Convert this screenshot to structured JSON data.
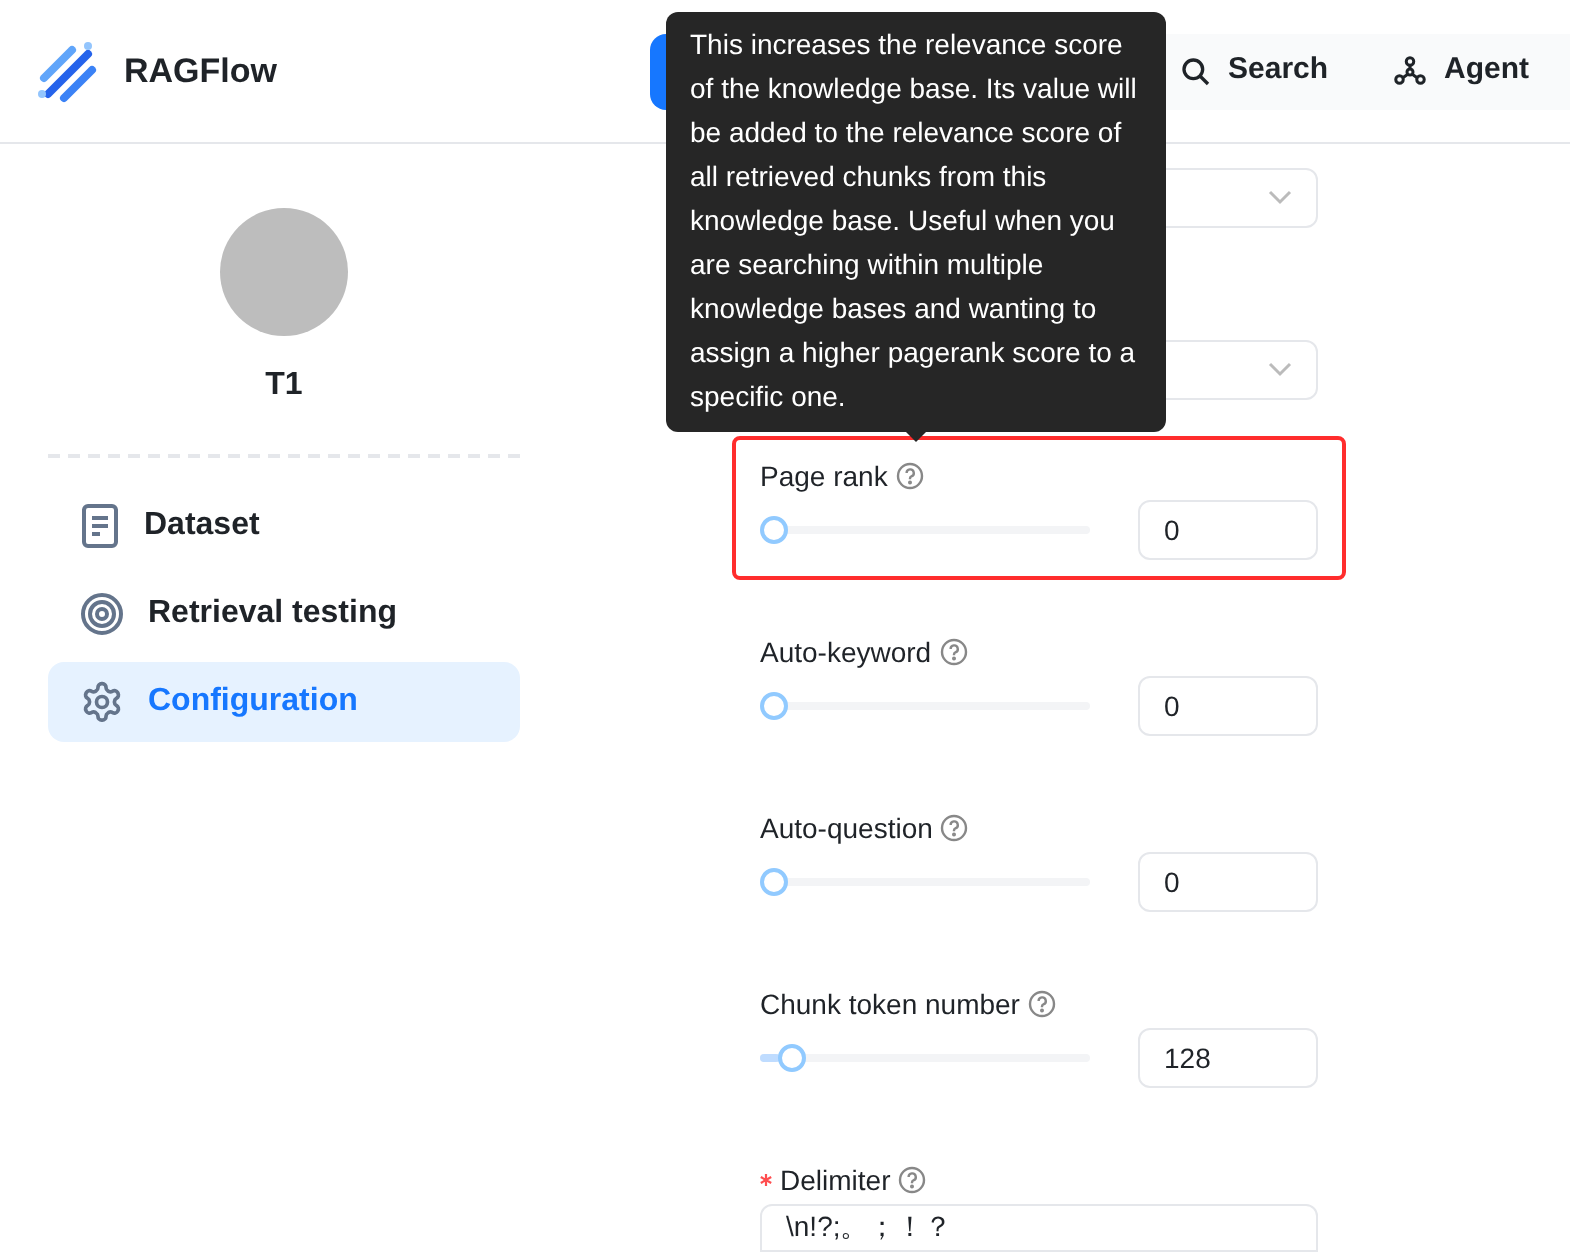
{
  "app": {
    "name": "RAGFlow"
  },
  "nav": [
    {
      "selected": true
    },
    {
      "label": "Search",
      "selected": false
    },
    {
      "label": "Agent",
      "selected": false
    }
  ],
  "sidebar": {
    "avatar_name": "T1",
    "items": [
      {
        "label": "Dataset",
        "selected": false
      },
      {
        "label": "Retrieval testing",
        "selected": false
      },
      {
        "label": "Configuration",
        "selected": true
      }
    ]
  },
  "form": [
    {
      "kind": "select",
      "highlighted": false
    },
    {
      "kind": "select",
      "highlighted": false
    },
    {
      "kind": "slider",
      "label": "Page rank",
      "required": false,
      "level": 0,
      "value": "0",
      "highlighted": true
    },
    {
      "kind": "slider",
      "label": "Auto-keyword",
      "required": false,
      "level": 0,
      "value": "0",
      "highlighted": false
    },
    {
      "kind": "slider",
      "label": "Auto-question",
      "required": false,
      "level": 0,
      "value": "0",
      "highlighted": false
    },
    {
      "kind": "slider",
      "label": "Chunk token number",
      "required": false,
      "level": 0.0625,
      "value": "128",
      "highlighted": false
    },
    {
      "kind": "text",
      "label": "Delimiter",
      "required": true,
      "value": "\\n!?;。；！？",
      "highlighted": false
    }
  ],
  "tooltip": {
    "text": "This increases the relevance score of the knowledge base. Its value will be added to the relevance score of all retrieved chunks from this knowledge base. Useful when you are searching within multiple knowledge bases and wanting to assign a higher pagerank score to a specific one."
  }
}
